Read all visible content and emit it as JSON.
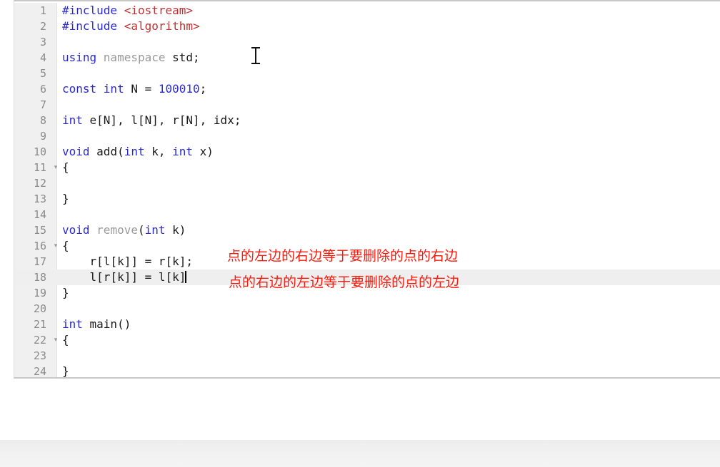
{
  "editor": {
    "language": "cpp",
    "current_line": 18,
    "gutter": {
      "fold_marker_glyph": "▾",
      "fold_lines": [
        11,
        16,
        22
      ]
    },
    "lines": [
      {
        "no": "1",
        "tokens": [
          {
            "t": "#include ",
            "c": "kw"
          },
          {
            "t": "<iostream>",
            "c": "str"
          }
        ]
      },
      {
        "no": "2",
        "tokens": [
          {
            "t": "#include ",
            "c": "kw"
          },
          {
            "t": "<algorithm>",
            "c": "str"
          }
        ]
      },
      {
        "no": "3",
        "tokens": []
      },
      {
        "no": "4",
        "tokens": [
          {
            "t": "using ",
            "c": "kw"
          },
          {
            "t": "namespace ",
            "c": "dim"
          },
          {
            "t": "std;",
            "c": "pln"
          }
        ]
      },
      {
        "no": "5",
        "tokens": []
      },
      {
        "no": "6",
        "tokens": [
          {
            "t": "const ",
            "c": "kw"
          },
          {
            "t": "int ",
            "c": "kw"
          },
          {
            "t": "N = ",
            "c": "pln"
          },
          {
            "t": "100010",
            "c": "num"
          },
          {
            "t": ";",
            "c": "pln"
          }
        ]
      },
      {
        "no": "7",
        "tokens": []
      },
      {
        "no": "8",
        "tokens": [
          {
            "t": "int ",
            "c": "kw"
          },
          {
            "t": "e[N], l[N], r[N], idx;",
            "c": "pln"
          }
        ]
      },
      {
        "no": "9",
        "tokens": []
      },
      {
        "no": "10",
        "tokens": [
          {
            "t": "void ",
            "c": "kw"
          },
          {
            "t": "add(",
            "c": "pln"
          },
          {
            "t": "int ",
            "c": "kw"
          },
          {
            "t": "k, ",
            "c": "pln"
          },
          {
            "t": "int ",
            "c": "kw"
          },
          {
            "t": "x)",
            "c": "pln"
          }
        ]
      },
      {
        "no": "11",
        "tokens": [
          {
            "t": "{",
            "c": "pln"
          }
        ]
      },
      {
        "no": "12",
        "tokens": []
      },
      {
        "no": "13",
        "tokens": [
          {
            "t": "}",
            "c": "pln"
          }
        ]
      },
      {
        "no": "14",
        "tokens": []
      },
      {
        "no": "15",
        "tokens": [
          {
            "t": "void ",
            "c": "kw"
          },
          {
            "t": "remove",
            "c": "dim"
          },
          {
            "t": "(",
            "c": "pln"
          },
          {
            "t": "int ",
            "c": "kw"
          },
          {
            "t": "k)",
            "c": "pln"
          }
        ]
      },
      {
        "no": "16",
        "tokens": [
          {
            "t": "{",
            "c": "pln"
          }
        ]
      },
      {
        "no": "17",
        "tokens": [
          {
            "t": "    r[l[k]] = r[k];",
            "c": "pln"
          }
        ]
      },
      {
        "no": "18",
        "tokens": [
          {
            "t": "    l[r[k]] = l[k]",
            "c": "pln"
          }
        ]
      },
      {
        "no": "19",
        "tokens": [
          {
            "t": "}",
            "c": "pln"
          }
        ]
      },
      {
        "no": "20",
        "tokens": []
      },
      {
        "no": "21",
        "tokens": [
          {
            "t": "int ",
            "c": "kw"
          },
          {
            "t": "main()",
            "c": "pln"
          }
        ]
      },
      {
        "no": "22",
        "tokens": [
          {
            "t": "{",
            "c": "pln"
          }
        ]
      },
      {
        "no": "23",
        "tokens": []
      },
      {
        "no": "24",
        "tokens": [
          {
            "t": "}",
            "c": "pln"
          }
        ]
      }
    ]
  },
  "annotations": [
    {
      "id": "annot-1",
      "text": "点的左边的右边等于要删除的点的右边"
    },
    {
      "id": "annot-2",
      "text": "点的右边的左边等于要删除的点的左边"
    }
  ],
  "colors": {
    "keyword": "#2a2ad0",
    "string": "#bf3030",
    "number": "#2a2ad0",
    "dim": "#9a9a9a",
    "plain": "#1a1a1a",
    "annotation_red": "#fb1b0d",
    "gutter_bg": "#f0f0f0",
    "current_line_bg": "#efefef",
    "editor_bg": "#ffffff"
  }
}
